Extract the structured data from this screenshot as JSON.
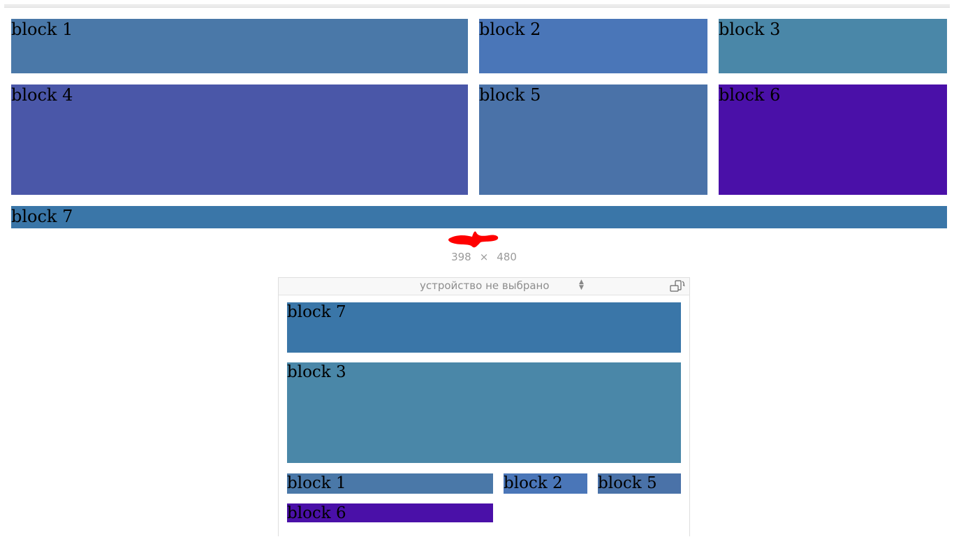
{
  "desktop": {
    "blocks": [
      {
        "label": "block 1",
        "color": "#4a78a8"
      },
      {
        "label": "block 2",
        "color": "#4a76b8"
      },
      {
        "label": "block 3",
        "color": "#4a87a8"
      },
      {
        "label": "block 4",
        "color": "#4a57a8"
      },
      {
        "label": "block 5",
        "color": "#4a72a8"
      },
      {
        "label": "block 6",
        "color": "#4a10a8"
      },
      {
        "label": "block 7",
        "color": "#3a76a8"
      }
    ]
  },
  "viewport_size": {
    "width": "398",
    "separator": "×",
    "height": "480"
  },
  "device_toolbar": {
    "device_select": "устройство не выбрано"
  },
  "mobile": {
    "blocks": [
      {
        "label": "block 7",
        "color": "#3a76a8"
      },
      {
        "label": "block 3",
        "color": "#4a87a8"
      },
      {
        "label": "block 1",
        "color": "#4a78a8"
      },
      {
        "label": "block 2",
        "color": "#4a76b8"
      },
      {
        "label": "block 5",
        "color": "#4a72a8"
      },
      {
        "label": "block 6",
        "color": "#4a10a8"
      }
    ]
  },
  "colors": {
    "annotation": "#ff0000"
  }
}
